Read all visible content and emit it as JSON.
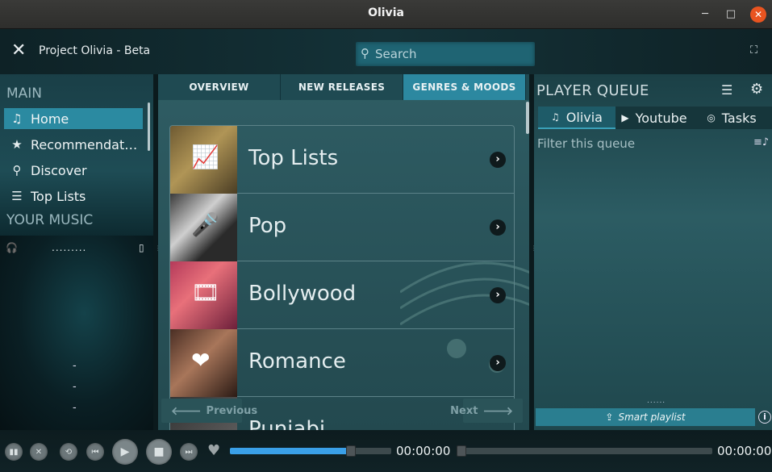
{
  "window": {
    "title": "Olivia",
    "minimize_icon": "minimize-icon",
    "maximize_icon": "maximize-icon",
    "close_icon": "close-icon"
  },
  "header": {
    "close_glyph": "✕",
    "app_name": "Project Olivia - Beta",
    "search_placeholder": "Search",
    "fullscreen_glyph": "⛶"
  },
  "sidebar": {
    "section_main": "MAIN",
    "items": [
      {
        "label": "Home",
        "icon": "♫",
        "active": true
      },
      {
        "label": "Recommendations",
        "icon": "★",
        "active": false
      },
      {
        "label": "Discover",
        "icon": "⚲",
        "active": false
      },
      {
        "label": "Top Lists",
        "icon": "☰",
        "active": false
      }
    ],
    "section_your_music": "YOUR MUSIC"
  },
  "now_playing": {
    "dots": ".........",
    "lines": [
      "-",
      "-",
      "-"
    ]
  },
  "center": {
    "tabs": [
      {
        "label": "OVERVIEW",
        "active": false
      },
      {
        "label": "NEW RELEASES",
        "active": false
      },
      {
        "label": "GENRES & MOODS",
        "active": true
      }
    ],
    "genres": [
      {
        "name": "Top Lists",
        "icon": "📈"
      },
      {
        "name": "Pop",
        "icon": "🎤"
      },
      {
        "name": "Bollywood",
        "icon": "🎞"
      },
      {
        "name": "Romance",
        "icon": "❤"
      },
      {
        "name": "Punjabi",
        "icon": ""
      }
    ],
    "previous_label": "Previous",
    "next_label": "Next"
  },
  "queue": {
    "title": "PLAYER QUEUE",
    "tabs": [
      {
        "label": "Olivia",
        "icon": "♫",
        "active": true
      },
      {
        "label": "Youtube",
        "icon": "▶",
        "active": false
      },
      {
        "label": "Tasks",
        "icon": "◎",
        "active": false
      }
    ],
    "filter_placeholder": "Filter this queue",
    "smart_playlist": "Smart playlist",
    "info_glyph": "i",
    "grip_dots": "......"
  },
  "player": {
    "elapsed": "00:00:00",
    "total": "00:00:00",
    "volume": 0.75
  },
  "colors": {
    "accent": "#2c88a0",
    "seek_fill": "#3aa0e8",
    "close_button": "#e95420"
  }
}
